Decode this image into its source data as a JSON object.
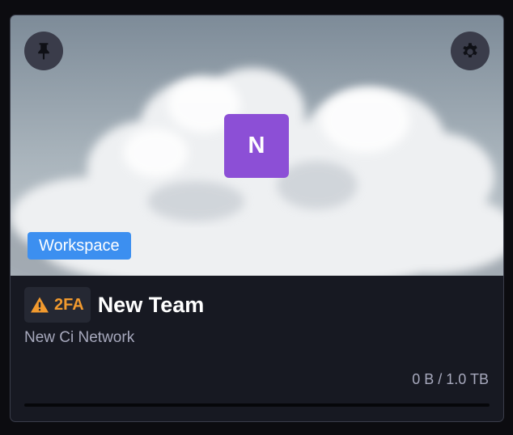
{
  "card": {
    "pin_icon": "pin-icon",
    "settings_icon": "gear-icon",
    "avatar_letter": "N",
    "type_badge": "Workspace",
    "security_badge": {
      "icon": "warning-icon",
      "label": "2FA"
    },
    "team_name": "New Team",
    "network_name": "New Ci Network",
    "storage": {
      "text": "0 B / 1.0 TB",
      "used_fraction": 0
    }
  },
  "colors": {
    "avatar": "#8c4fd6",
    "badge": "#3c8ff0",
    "warning": "#f29a2e",
    "card_bg": "#171922"
  }
}
